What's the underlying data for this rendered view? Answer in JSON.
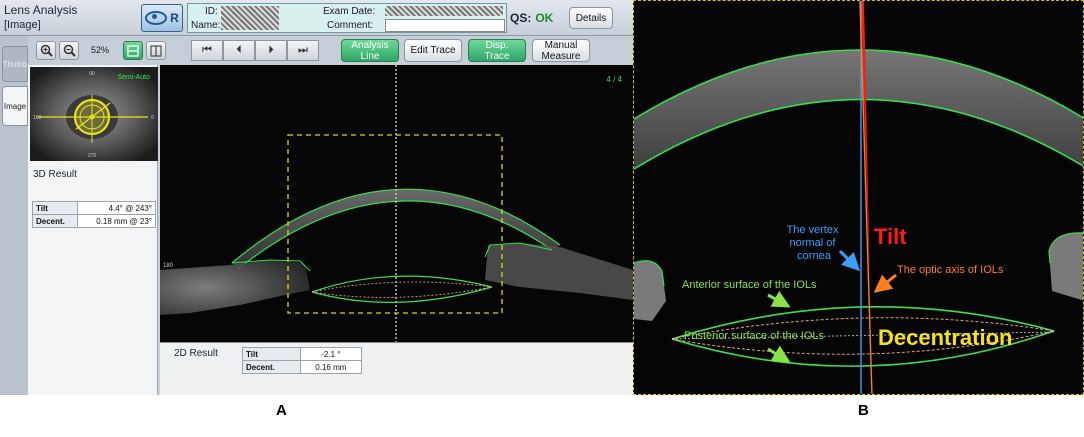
{
  "panel_a": {
    "window_title": "Lens Analysis",
    "window_subtitle": "[Image]",
    "eye_button": "R",
    "info": {
      "id_label": "ID:",
      "name_label": "Name:",
      "exam_date_label": "Exam Date:",
      "comment_label": "Comment:"
    },
    "qs_label": "QS:",
    "qs_value": "OK",
    "details_button": "Details",
    "zoom_level": "52%",
    "buttons": {
      "analysis_line": "Analysis\nLine",
      "edit_trace": "Edit Trace",
      "disp_trace": "Disp.\nTrace",
      "manual_measure": "Manual\nMeasure"
    },
    "nav": {
      "first": "⏮",
      "prev": "⏴",
      "next": "⏵",
      "last": "⏭"
    },
    "tabs": {
      "thumbnail": "Thumb",
      "image": "Image"
    },
    "thumb_overlay": {
      "mode": "Semi-Auto",
      "top": "90",
      "bottom": "270",
      "left": "180",
      "right": "0"
    },
    "result_3d": {
      "heading": "3D Result",
      "tilt_label": "Tilt",
      "tilt_value": "4.4°  @ 243°",
      "decent_label": "Decent.",
      "decent_value": "0.18 mm  @ 23°"
    },
    "image_counter": "4 / 4",
    "oct_left_tick": "180",
    "result_2d": {
      "heading": "2D Result",
      "tilt_label": "Tilt",
      "tilt_value": "-2.1 °",
      "decent_label": "Decent.",
      "decent_value": "0.16 mm"
    },
    "panel_tag": "A"
  },
  "panel_b": {
    "label_vertex": "The vertex\nnormal of\ncornea",
    "label_tilt": "Tilt",
    "label_optic_axis": "The optic axis of IOLs",
    "label_anterior": "Anterior surface of the IOLs",
    "label_posterior": "Posterior surface of the IOLs",
    "label_decentration": "Decentration",
    "panel_tag": "B"
  },
  "colors": {
    "trace_green": "#33e04a",
    "lens_green": "#3ce04f",
    "lens_orange": "#e8a07a",
    "tilt_red": "#ff1a1a",
    "vertex_blue": "#3aa0ff",
    "optic_orange": "#ff7f1a",
    "decentration_yellow": "#f4e21a",
    "box_yellow": "#e6d21a"
  }
}
